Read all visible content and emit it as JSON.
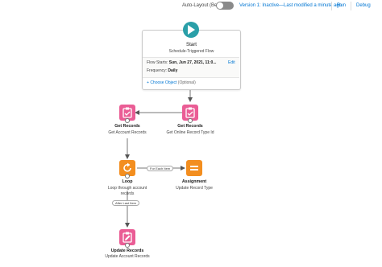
{
  "toolbar": {
    "auto_layout_label": "Auto-Layout (Beta)",
    "version_status": "Version 1: Inactive—Last modified a minute ago",
    "run_label": "Run",
    "debug_label": "Debug"
  },
  "start": {
    "title": "Start",
    "subtitle": "Schedule-Triggered Flow",
    "flow_starts_label": "Flow Starts:",
    "flow_starts_value": "Sun, Jun 27, 2021, 11:0...",
    "edit_label": "Edit",
    "frequency_label": "Frequency:",
    "frequency_value": "Daily",
    "choose_object_label": "Choose Object",
    "choose_object_optional": "(Optional)"
  },
  "nodes": {
    "get_online": {
      "type": "Get Records",
      "label": "Get Online Record Type Id"
    },
    "get_account": {
      "type": "Get Records",
      "label": "Get Account Records"
    },
    "loop": {
      "type": "Loop",
      "label": "Loop through account records"
    },
    "assignment": {
      "type": "Assignment",
      "label": "Update Record Type"
    },
    "update": {
      "type": "Update Records",
      "label": "Update Account Records"
    }
  },
  "connectors": {
    "for_each": "For Each Item",
    "after_last": "After Last Item"
  },
  "colors": {
    "start": "#2a9fa8",
    "records": "#ea5d95",
    "loop": "#f38e1f",
    "assignment": "#f38e1f",
    "link": "#0176d3"
  }
}
